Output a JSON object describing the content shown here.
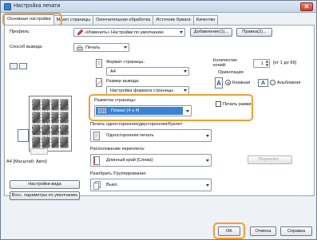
{
  "window": {
    "title": "Настройка печати",
    "close_symbol": "✕"
  },
  "tabs": [
    {
      "label": "Основные настройки",
      "active": true
    },
    {
      "label": "Макет страницы"
    },
    {
      "label": "Окончательная обработка"
    },
    {
      "label": "Источник бумаги"
    },
    {
      "label": "Качество"
    }
  ],
  "profile": {
    "label": "Профиль:",
    "value": "«Изменить» Настройки по умолчанию",
    "add_button": "Добавление(1)...",
    "edit_button": "Правка(2)..."
  },
  "output_method": {
    "label": "Способ вывода:",
    "value": "Печать"
  },
  "page_size": {
    "label": "Формат страницы:",
    "value": "A4"
  },
  "output_size": {
    "label": "Размер вывода:",
    "value": "Настройка формата страницы"
  },
  "copies": {
    "label": "Количество копий:",
    "value": "1",
    "range": "[от 1 до 99]"
  },
  "orientation": {
    "label": "Ориентация",
    "portrait_icon": "A",
    "portrait_label": "Книжная",
    "landscape_icon": "A",
    "landscape_label": "Альбомная",
    "selected": "portrait"
  },
  "page_layout": {
    "label": "Разметка страницы:",
    "value": "Плакат [4 x 4]",
    "frame_checkbox": "Печать рамки",
    "frame_checked": false
  },
  "duplex": {
    "label": "Печать односторонняя/двусторонняя/буклет:",
    "value": "Односторонняя печать"
  },
  "binding": {
    "label": "Расположение переплета:",
    "value": "Длинный край [Слева]",
    "button": "Переплет..."
  },
  "collate": {
    "label": "Разобрать /Группирование:",
    "value": "Выкл."
  },
  "preview_status": "A4 [Масштаб: Авто]",
  "left_buttons": {
    "view_settings": "Настройки вида",
    "restore_defaults": "Восс. параметры по умолчанию"
  },
  "footer": {
    "ok": "OK",
    "cancel": "Отмена",
    "help": "Справка"
  },
  "accent_color": "#f0a030",
  "selection_color": "#3b82d6"
}
